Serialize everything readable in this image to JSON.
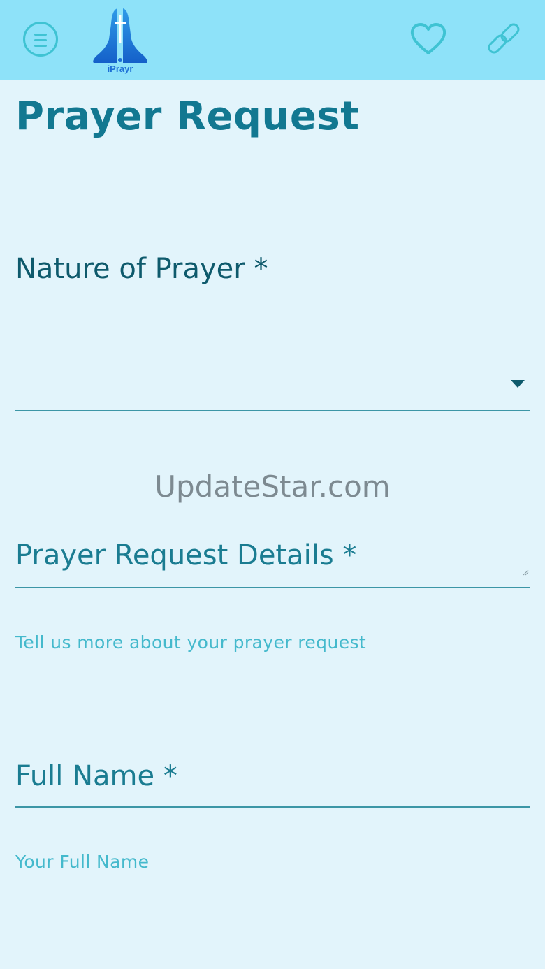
{
  "header": {
    "menu_icon": "menu-icon",
    "logo_text": "iPrayr",
    "favorite_icon": "heart-icon",
    "share_icon": "link-icon",
    "colors": {
      "bar": "#8ee2f9",
      "icon": "#3fc3d3",
      "logo": "#1d6fd6"
    }
  },
  "page": {
    "title": "Prayer Request"
  },
  "form": {
    "nature": {
      "label": "Nature of Prayer *",
      "selected": ""
    },
    "watermark": "UpdateStar.com",
    "details": {
      "label": "Prayer Request Details *",
      "hint": "Tell us more about your prayer request"
    },
    "full_name": {
      "label": "Full Name *",
      "hint": "Your Full Name"
    }
  }
}
